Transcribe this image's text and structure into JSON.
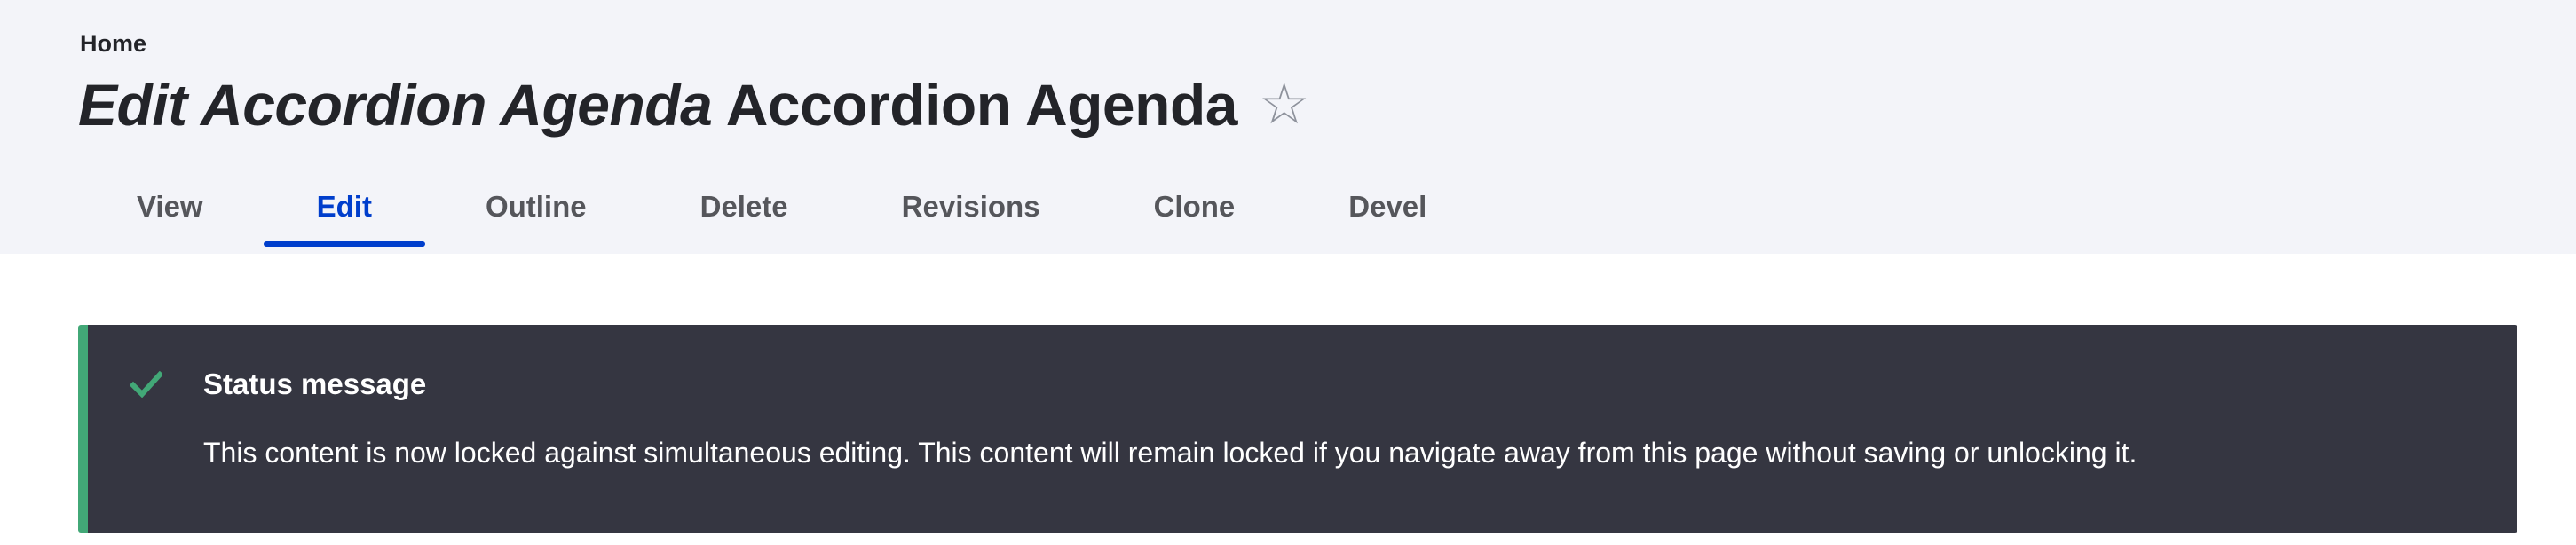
{
  "breadcrumb": {
    "home_label": "Home"
  },
  "title": {
    "italic_part": "Edit Accordion Agenda",
    "plain_part": "Accordion Agenda",
    "star_glyph": "☆"
  },
  "tabs": [
    {
      "label": "View",
      "active": false
    },
    {
      "label": "Edit",
      "active": true
    },
    {
      "label": "Outline",
      "active": false
    },
    {
      "label": "Delete",
      "active": false
    },
    {
      "label": "Revisions",
      "active": false
    },
    {
      "label": "Clone",
      "active": false
    },
    {
      "label": "Devel",
      "active": false
    }
  ],
  "status_message": {
    "icon": "check-icon",
    "title": "Status message",
    "text": "This content is now locked against simultaneous editing. This content will remain locked if you navigate away from this page without saving or unlocking it."
  },
  "colors": {
    "header_bg": "#f3f4f9",
    "accent": "#003ecc",
    "status_bg": "#353641",
    "status_border": "#42a877"
  }
}
